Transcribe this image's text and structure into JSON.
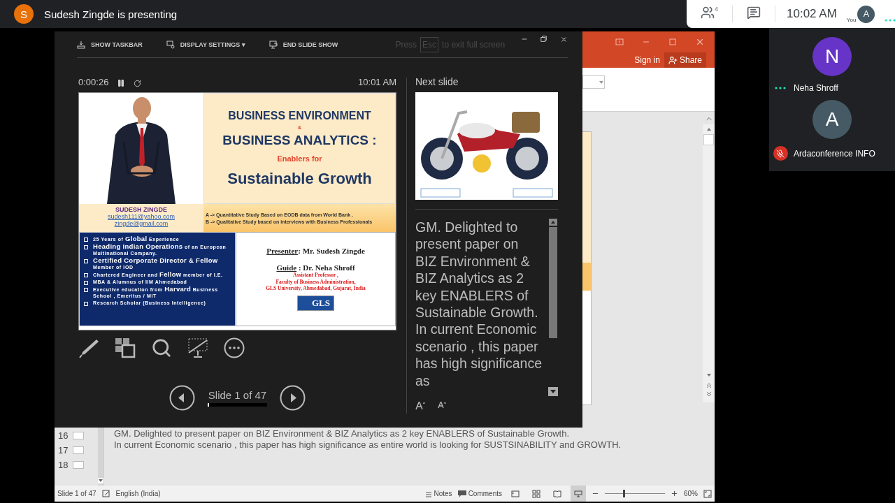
{
  "meeting": {
    "presenter_initial": "S",
    "banner": "Sudesh Zingde is presenting",
    "participant_count": "4",
    "time": "10:02 AM",
    "self": {
      "initial": "A",
      "label": "You",
      "speaking": true
    }
  },
  "participants": [
    {
      "initial": "N",
      "name": "Neha Shroff",
      "color": "#6634c6",
      "speaking": true,
      "muted": false
    },
    {
      "initial": "A",
      "name": "Ardaconference INFO",
      "color": "#455a64",
      "speaking": false,
      "muted": true
    }
  ],
  "powerpoint": {
    "sign_in": "Sign in",
    "share": "Share",
    "thumbnails": [
      {
        "number": "16"
      },
      {
        "number": "17"
      },
      {
        "number": "18"
      }
    ],
    "notes": [
      "GM. Delighted to present paper on BIZ Environment & BIZ Analytics as 2 key ENABLERS of Sustainable Growth.",
      "In current Economic scenario , this paper has high significance as entire world is looking for SUSTSINABILITY and GROWTH."
    ],
    "status_bar": {
      "slide": "Slide 1 of 47",
      "language": "English (India)",
      "notes": "Notes",
      "comments": "Comments",
      "views": [
        {
          "selected": false
        },
        {
          "selected": false
        },
        {
          "selected": false
        },
        {
          "selected": true
        }
      ],
      "zoom": {
        "level": 0.3,
        "reading": "60%"
      }
    }
  },
  "presenter_view": {
    "toolbar": [
      "SHOW TASKBAR",
      "DISPLAY SETTINGS ▾",
      "END SLIDE SHOW"
    ],
    "esc_hint": {
      "before": "Press",
      "key": "Esc",
      "after": "to exit full screen"
    },
    "timer": "0:00:26",
    "clock": "10:01 AM",
    "slide": {
      "title": {
        "line1": "BUSINESS ENVIRONMENT",
        "amp": "&",
        "line2": "BUSINESS ANALYTICS :",
        "sub": "Enablers for",
        "line3": "Sustainable Growth"
      },
      "author": {
        "name": "SUDESH ZINGDE",
        "emails": [
          "sudesh111@yahoo.com",
          "zingde@gmail.com"
        ]
      },
      "studies": [
        "A -> Quantitative Study Based on EODB data from World Bank .",
        "B -> Qualitative Study based on interviews with Business Professionals"
      ],
      "bullets": [
        "25 Years of **Global** Experience",
        "**Heading Indian Operations** of an European Multinational Company.",
        "**Certified Corporate Director & Fellow** Member of IOD",
        "Chartered Engineer and **Fellow** member of I.E.",
        "MBA & Alumnus of IIM Ahmedabad",
        "Executive education from **Harvard** Business School , Emeritus / MIT",
        "Research Scholar (Business Intelligence)"
      ],
      "presenter": {
        "label": "Presenter",
        "value": ": Mr. Sudesh Zingde"
      },
      "guide": {
        "label": "Guide",
        "value": " : Dr. Neha Shroff"
      },
      "affiliation": [
        "Assistant Professor ,",
        "Faculty of Business Administration,",
        "GLS University, Ahmedabad, Gujarat, India"
      ],
      "logo": "GLS"
    },
    "slide_counter": "Slide 1 of 47",
    "progress": {
      "level": 0.02
    },
    "next_label": "Next slide",
    "notes": "GM. Delighted to present paper on BIZ Environment & BIZ Analytics as 2 key ENABLERS of Sustainable Growth. In current Economic scenario , this paper has high significance as"
  }
}
